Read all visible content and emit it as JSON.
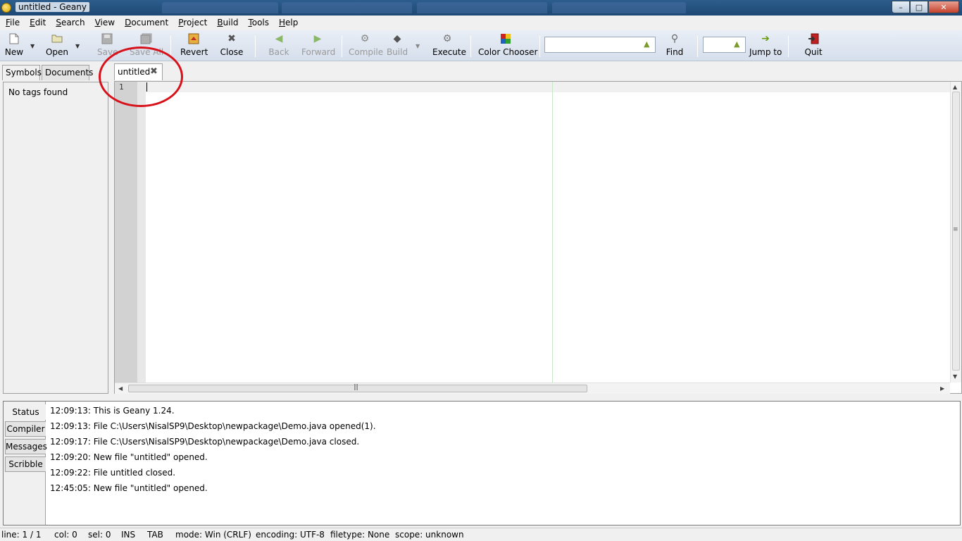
{
  "window": {
    "title": "untitled - Geany",
    "controls": {
      "minimize": "–",
      "maximize": "□",
      "close": "✕"
    }
  },
  "menu": [
    {
      "label": "File",
      "key": "F",
      "rest": "ile"
    },
    {
      "label": "Edit",
      "key": "E",
      "rest": "dit"
    },
    {
      "label": "Search",
      "key": "S",
      "rest": "earch"
    },
    {
      "label": "View",
      "key": "V",
      "rest": "iew"
    },
    {
      "label": "Document",
      "key": "D",
      "rest": "ocument"
    },
    {
      "label": "Project",
      "key": "P",
      "rest": "roject"
    },
    {
      "label": "Build",
      "key": "B",
      "rest": "uild"
    },
    {
      "label": "Tools",
      "key": "T",
      "rest": "ools"
    },
    {
      "label": "Help",
      "key": "H",
      "rest": "elp"
    }
  ],
  "toolbar": {
    "new": "New",
    "open": "Open",
    "save": "Save",
    "save_all": "Save All",
    "revert": "Revert",
    "close": "Close",
    "back": "Back",
    "forward": "Forward",
    "compile": "Compile",
    "build": "Build",
    "execute": "Execute",
    "color_chooser": "Color Chooser",
    "search_value": "",
    "find": "Find",
    "goto_value": "",
    "jump_to": "Jump to",
    "quit": "Quit"
  },
  "sidebar": {
    "tabs": [
      "Symbols",
      "Documents"
    ],
    "active_tab": "Symbols",
    "message": "No tags found"
  },
  "editor": {
    "tab_label": "untitled",
    "line_number": "1",
    "content": ""
  },
  "messages": {
    "tabs": [
      "Status",
      "Compiler",
      "Messages",
      "Scribble"
    ],
    "active_tab": "Status",
    "log": [
      "12:09:13: This is Geany 1.24.",
      "12:09:13: File C:\\Users\\NisalSP9\\Desktop\\newpackage\\Demo.java opened(1).",
      "12:09:17: File C:\\Users\\NisalSP9\\Desktop\\newpackage\\Demo.java closed.",
      "12:09:20: New file \"untitled\" opened.",
      "12:09:22: File untitled closed.",
      "12:45:05: New file \"untitled\" opened."
    ]
  },
  "status": {
    "line": "line: 1 / 1",
    "col": "col: 0",
    "sel": "sel: 0",
    "mode_ins": "INS",
    "indent": "TAB",
    "eol_mode": "mode: Win (CRLF)",
    "encoding": "encoding: UTF-8",
    "filetype": "filetype: None",
    "scope": "scope: unknown"
  },
  "colors": {
    "annotation": "#d8121b",
    "titlebar": "#2c5d8c",
    "long_line_marker": "#c8e6c8"
  }
}
